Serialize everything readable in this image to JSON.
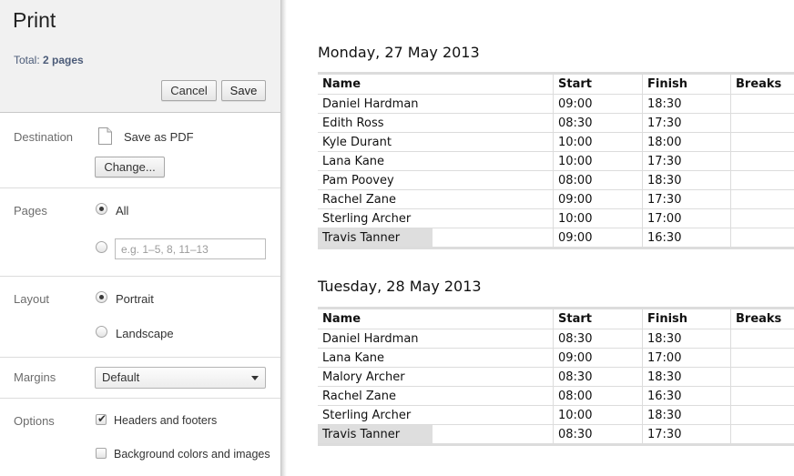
{
  "sidebar": {
    "title": "Print",
    "total_label": "Total:",
    "total_pages": "2 pages",
    "cancel_label": "Cancel",
    "save_label": "Save",
    "destination": {
      "label": "Destination",
      "value": "Save as PDF",
      "icon": "document-icon",
      "change_label": "Change..."
    },
    "pages": {
      "label": "Pages",
      "all_label": "All",
      "all_selected": true,
      "range_placeholder": "e.g. 1–5, 8, 11–13",
      "range_value": ""
    },
    "layout": {
      "label": "Layout",
      "portrait_label": "Portrait",
      "landscape_label": "Landscape",
      "selected": "Portrait"
    },
    "margins": {
      "label": "Margins",
      "value": "Default"
    },
    "options": {
      "label": "Options",
      "headers_footers_label": "Headers and footers",
      "headers_footers_checked": true,
      "background_label": "Background colors and images",
      "background_checked": false
    }
  },
  "preview": {
    "days": [
      {
        "heading": "Monday, 27 May 2013",
        "columns": [
          "Name",
          "Start",
          "Finish",
          "Breaks"
        ],
        "rows": [
          [
            "Daniel Hardman",
            "09:00",
            "18:30",
            ""
          ],
          [
            "Edith Ross",
            "08:30",
            "17:30",
            ""
          ],
          [
            "Kyle Durant",
            "10:00",
            "18:00",
            ""
          ],
          [
            "Lana Kane",
            "10:00",
            "17:30",
            ""
          ],
          [
            "Pam Poovey",
            "08:00",
            "18:30",
            ""
          ],
          [
            "Rachel Zane",
            "09:00",
            "17:30",
            ""
          ],
          [
            "Sterling Archer",
            "10:00",
            "17:00",
            ""
          ],
          [
            "Travis Tanner",
            "09:00",
            "16:30",
            ""
          ]
        ]
      },
      {
        "heading": "Tuesday, 28 May 2013",
        "columns": [
          "Name",
          "Start",
          "Finish",
          "Breaks"
        ],
        "rows": [
          [
            "Daniel Hardman",
            "08:30",
            "18:30",
            ""
          ],
          [
            "Lana Kane",
            "09:00",
            "17:00",
            ""
          ],
          [
            "Malory Archer",
            "08:30",
            "18:30",
            ""
          ],
          [
            "Rachel Zane",
            "08:00",
            "16:30",
            ""
          ],
          [
            "Sterling Archer",
            "10:00",
            "18:30",
            ""
          ],
          [
            "Travis Tanner",
            "08:30",
            "17:30",
            ""
          ]
        ]
      }
    ]
  }
}
